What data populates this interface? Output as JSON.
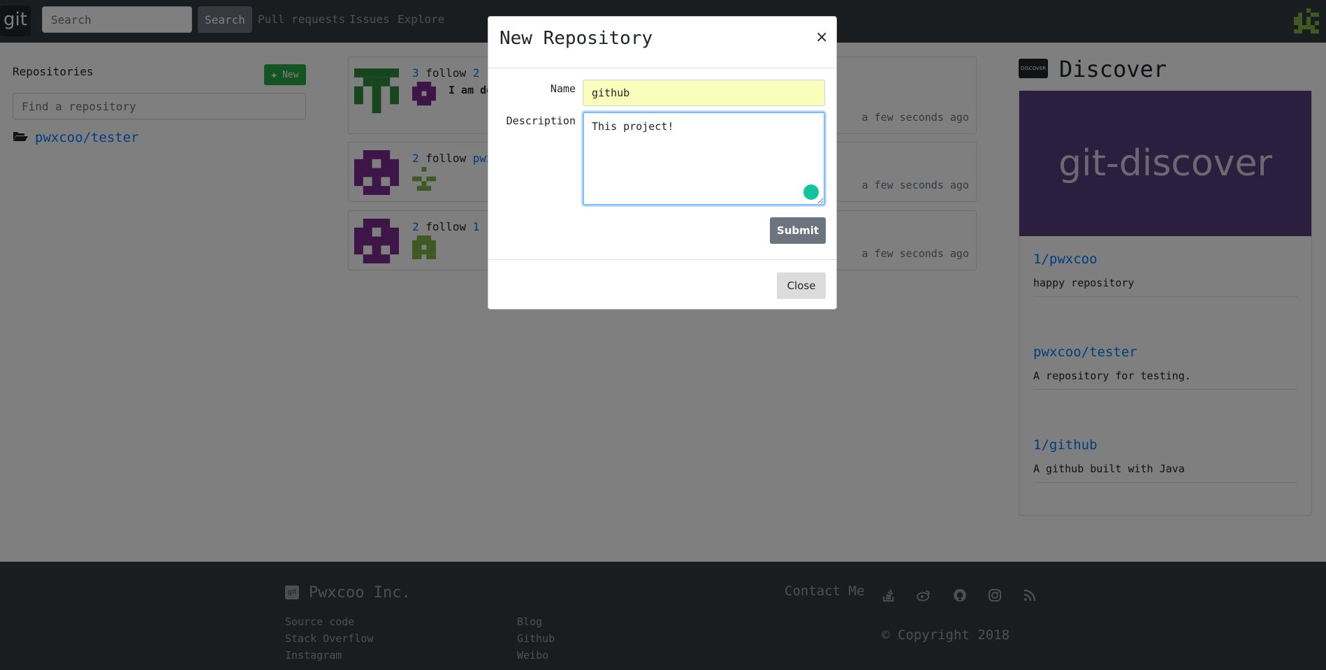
{
  "navbar": {
    "logo_text": "git",
    "search_placeholder": "Search",
    "search_button": "Search",
    "links": [
      "Pull requests",
      "Issues",
      "Explore"
    ]
  },
  "sidebar": {
    "title": "Repositories",
    "new_button": "New",
    "find_placeholder": "Find a repository",
    "repos": [
      "pwxcoo/tester"
    ]
  },
  "feed": [
    {
      "count": "3",
      "verb": "follow",
      "target": "2",
      "message": "I am do",
      "time": "a few seconds ago"
    },
    {
      "count": "2",
      "verb": "follow",
      "target": "pwx",
      "message": "",
      "time": "a few seconds ago"
    },
    {
      "count": "2",
      "verb": "follow",
      "target": "1",
      "message": "",
      "time": "a few seconds ago"
    }
  ],
  "discover": {
    "icon_text": "DISCOVER",
    "title": "Discover",
    "banner": "git-discover",
    "items": [
      {
        "name": "1/pwxcoo",
        "desc": "happy repository"
      },
      {
        "name": "pwxcoo/tester",
        "desc": "A repository for testing."
      },
      {
        "name": "1/github",
        "desc": "A github built with Java"
      }
    ]
  },
  "footer": {
    "brand_icon": "git",
    "brand": "Pwxcoo Inc.",
    "col1": [
      "Source code",
      "Stack Overflow",
      "Instagram"
    ],
    "col2": [
      "Blog",
      "Github",
      "Weibo"
    ],
    "contact": "Contact Me",
    "social_icons": [
      "stackoverflow-icon",
      "weibo-icon",
      "github-icon",
      "instagram-icon",
      "rss-icon"
    ],
    "copyright": "© Copyright 2018"
  },
  "modal": {
    "title": "New Repository",
    "close_x": "×",
    "name_label": "Name",
    "name_value": "github",
    "desc_label": "Description",
    "desc_value": "This project!",
    "submit": "Submit",
    "close": "Close"
  },
  "colors": {
    "navbar": "#343a40",
    "link": "#007bff",
    "new_button": "#28a745",
    "banner": "#563d7c",
    "name_field": "#fbfdbb",
    "avatar_purple": "#7b2a8d",
    "avatar_green": "#2e8b3d"
  }
}
